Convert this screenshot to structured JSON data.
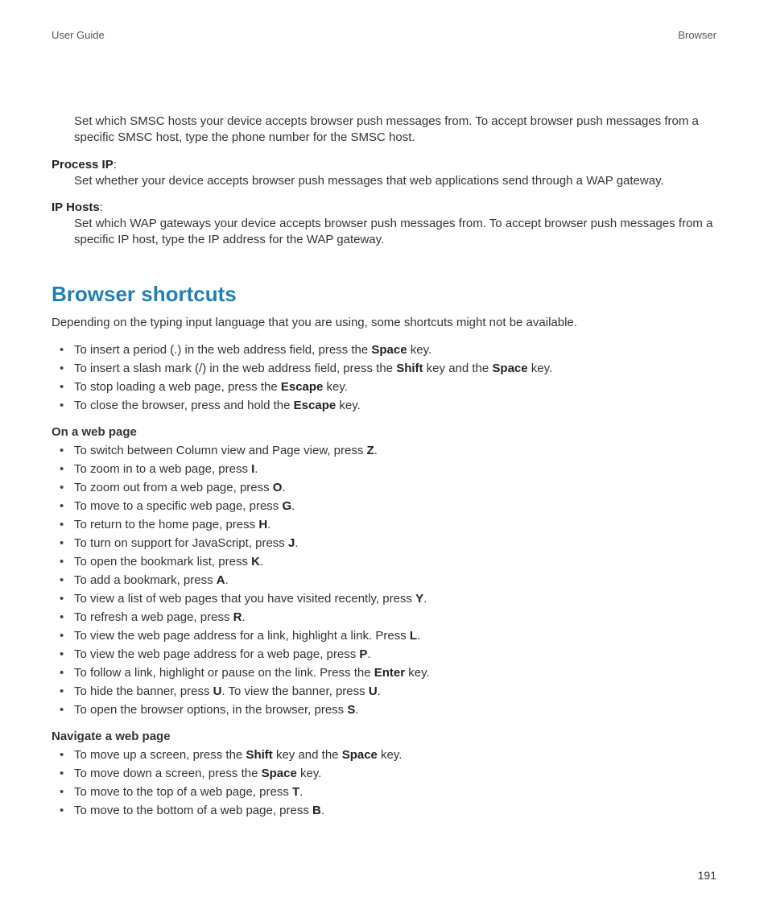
{
  "header": {
    "left": "User Guide",
    "right": "Browser"
  },
  "page_number": "191",
  "top_def_body": "Set which SMSC hosts your device accepts browser push messages from. To accept browser push messages from a specific SMSC host, type the phone number for the SMSC host.",
  "defs": [
    {
      "term": "Process IP",
      "body": "Set whether your device accepts browser push messages that web applications send through a WAP gateway."
    },
    {
      "term": "IP Hosts",
      "body": "Set which WAP gateways your device accepts browser push messages from. To accept browser push messages from a specific IP host, type the IP address for the WAP gateway."
    }
  ],
  "section_title": "Browser shortcuts",
  "intro": "Depending on the typing input language that you are using, some shortcuts might not be available.",
  "group1": [
    [
      [
        "To insert a period (.) in the web address field, press the "
      ],
      [
        "b",
        "Space"
      ],
      [
        " key."
      ]
    ],
    [
      [
        "To insert a slash mark (/) in the web address field, press the "
      ],
      [
        "b",
        "Shift"
      ],
      [
        " key and the "
      ],
      [
        "b",
        "Space"
      ],
      [
        " key."
      ]
    ],
    [
      [
        "To stop loading a web page, press the "
      ],
      [
        "b",
        "Escape"
      ],
      [
        " key."
      ]
    ],
    [
      [
        "To close the browser, press and hold the "
      ],
      [
        "b",
        "Escape"
      ],
      [
        " key."
      ]
    ]
  ],
  "sub2": "On a web page",
  "group2": [
    [
      [
        "To switch between Column view and Page view, press "
      ],
      [
        "b",
        "Z"
      ],
      [
        "."
      ]
    ],
    [
      [
        "To zoom in to a web page, press "
      ],
      [
        "b",
        "I"
      ],
      [
        "."
      ]
    ],
    [
      [
        "To zoom out from a web page, press "
      ],
      [
        "b",
        "O"
      ],
      [
        "."
      ]
    ],
    [
      [
        "To move to a specific web page, press "
      ],
      [
        "b",
        "G"
      ],
      [
        "."
      ]
    ],
    [
      [
        "To return to the home page, press "
      ],
      [
        "b",
        "H"
      ],
      [
        "."
      ]
    ],
    [
      [
        "To turn on support for JavaScript, press "
      ],
      [
        "b",
        "J"
      ],
      [
        "."
      ]
    ],
    [
      [
        "To open the bookmark list, press "
      ],
      [
        "b",
        "K"
      ],
      [
        "."
      ]
    ],
    [
      [
        "To add a bookmark, press "
      ],
      [
        "b",
        "A"
      ],
      [
        "."
      ]
    ],
    [
      [
        "To view a list of web pages that you have visited recently, press "
      ],
      [
        "b",
        "Y"
      ],
      [
        "."
      ]
    ],
    [
      [
        "To refresh a web page, press "
      ],
      [
        "b",
        "R"
      ],
      [
        "."
      ]
    ],
    [
      [
        "To view the web page address for a link, highlight a link. Press "
      ],
      [
        "b",
        "L"
      ],
      [
        "."
      ]
    ],
    [
      [
        "To view the web page address for a web page, press "
      ],
      [
        "b",
        "P"
      ],
      [
        "."
      ]
    ],
    [
      [
        "To follow a link, highlight or pause on the link. Press the "
      ],
      [
        "b",
        "Enter"
      ],
      [
        " key."
      ]
    ],
    [
      [
        "To hide the banner, press "
      ],
      [
        "b",
        "U"
      ],
      [
        ". To view the banner, press "
      ],
      [
        "b",
        "U"
      ],
      [
        "."
      ]
    ],
    [
      [
        "To open the browser options, in the browser, press "
      ],
      [
        "b",
        "S"
      ],
      [
        "."
      ]
    ]
  ],
  "sub3": "Navigate a web page",
  "group3": [
    [
      [
        "To move up a screen, press the "
      ],
      [
        "b",
        "Shift"
      ],
      [
        " key and the "
      ],
      [
        "b",
        "Space"
      ],
      [
        " key."
      ]
    ],
    [
      [
        "To move down a screen, press the "
      ],
      [
        "b",
        "Space"
      ],
      [
        " key."
      ]
    ],
    [
      [
        "To move to the top of a web page, press "
      ],
      [
        "b",
        "T"
      ],
      [
        "."
      ]
    ],
    [
      [
        "To move to the bottom of a web page, press "
      ],
      [
        "b",
        "B"
      ],
      [
        "."
      ]
    ]
  ]
}
